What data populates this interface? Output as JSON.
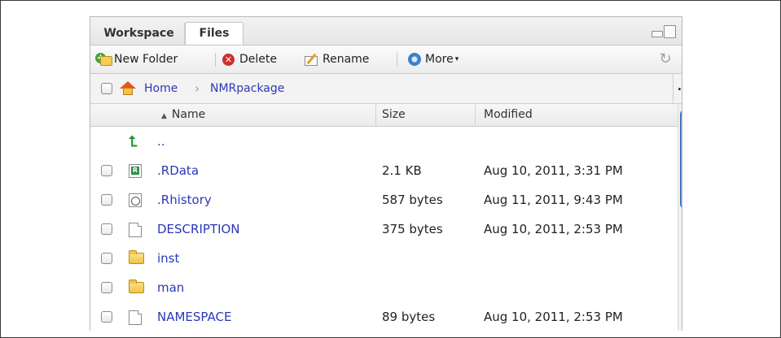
{
  "tabs": [
    {
      "label": "Workspace",
      "active": false
    },
    {
      "label": "Files",
      "active": true
    }
  ],
  "toolbar": {
    "new_folder_label": "New Folder",
    "delete_label": "Delete",
    "rename_label": "Rename",
    "more_label": "More",
    "caret": "▾",
    "refresh_icon": "refresh-icon"
  },
  "breadcrumb": {
    "home_label": "Home",
    "separator": "›",
    "current": "NMRpackage",
    "overflow_label": "…"
  },
  "columns": {
    "sort_indicator": "▲",
    "name": "Name",
    "size": "Size",
    "modified": "Modified"
  },
  "files": [
    {
      "icon": "parent-folder-up-icon",
      "name": "..",
      "size": "",
      "modified": "",
      "checkbox": false
    },
    {
      "icon": "rdata-file-icon",
      "name": ".RData",
      "size": "2.1 KB",
      "modified": "Aug 10, 2011, 3:31 PM",
      "checkbox": true
    },
    {
      "icon": "rhistory-file-icon",
      "name": ".Rhistory",
      "size": "587 bytes",
      "modified": "Aug 11, 2011, 9:43 PM",
      "checkbox": true
    },
    {
      "icon": "document-file-icon",
      "name": "DESCRIPTION",
      "size": "375 bytes",
      "modified": "Aug 10, 2011, 2:53 PM",
      "checkbox": true
    },
    {
      "icon": "folder-icon",
      "name": "inst",
      "size": "",
      "modified": "",
      "checkbox": true
    },
    {
      "icon": "folder-icon",
      "name": "man",
      "size": "",
      "modified": "",
      "checkbox": true
    },
    {
      "icon": "document-file-icon",
      "name": "NAMESPACE",
      "size": "89 bytes",
      "modified": "Aug 10, 2011, 2:53 PM",
      "checkbox": true
    }
  ],
  "colors": {
    "link_blue": "#2a39b8",
    "scroll_thumb": "#5a94d6",
    "folder_yellow": "#f1c442",
    "up_arrow_green": "#1f9a2f"
  }
}
